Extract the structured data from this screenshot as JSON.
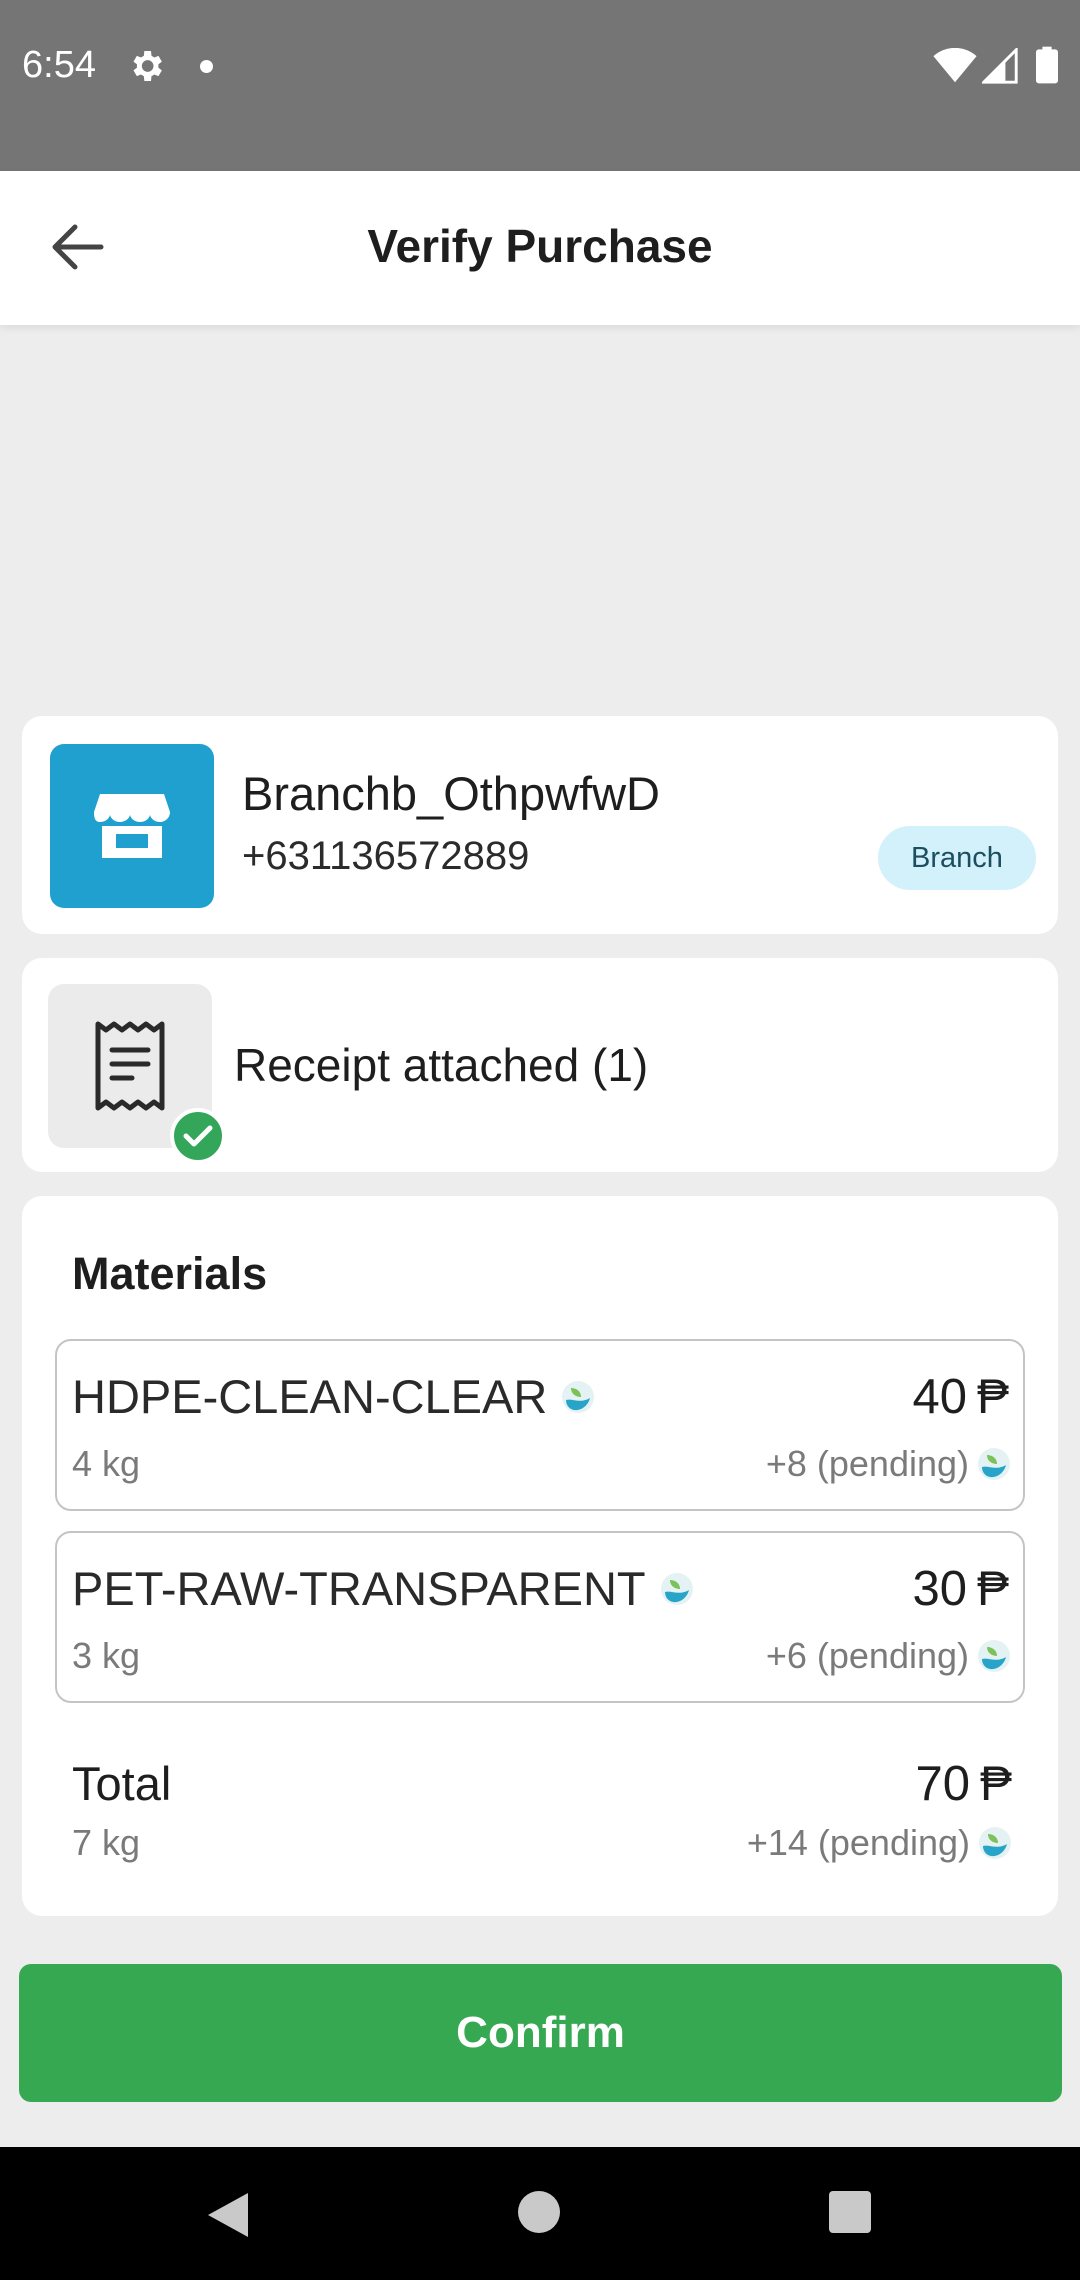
{
  "status_bar": {
    "time": "6:54"
  },
  "app_bar": {
    "title": "Verify Purchase"
  },
  "branch": {
    "name": "Branchb_OthpwfwD",
    "phone": "+631136572889",
    "badge": "Branch"
  },
  "receipt": {
    "label": "Receipt attached (1)"
  },
  "materials": {
    "title": "Materials",
    "items": [
      {
        "name": "HDPE-CLEAN-CLEAR",
        "weight": "4 kg",
        "price": "40",
        "pending": "+8 (pending)"
      },
      {
        "name": "PET-RAW-TRANSPARENT",
        "weight": "3 kg",
        "price": "30",
        "pending": "+6 (pending)"
      }
    ],
    "total": {
      "label": "Total",
      "weight": "7 kg",
      "price": "70",
      "pending": "+14 (pending)"
    },
    "currency_symbol": "₱"
  },
  "actions": {
    "confirm_label": "Confirm"
  },
  "colors": {
    "brand_blue": "#1fa0cf",
    "confirm_green": "#36a852",
    "check_green": "#33a65a",
    "badge_bg": "#d3f1fa"
  },
  "icons": {
    "back": "arrow-left-icon",
    "store": "storefront-icon",
    "receipt": "receipt-icon",
    "check": "check-circle-icon",
    "eco": "eco-token-icon"
  }
}
